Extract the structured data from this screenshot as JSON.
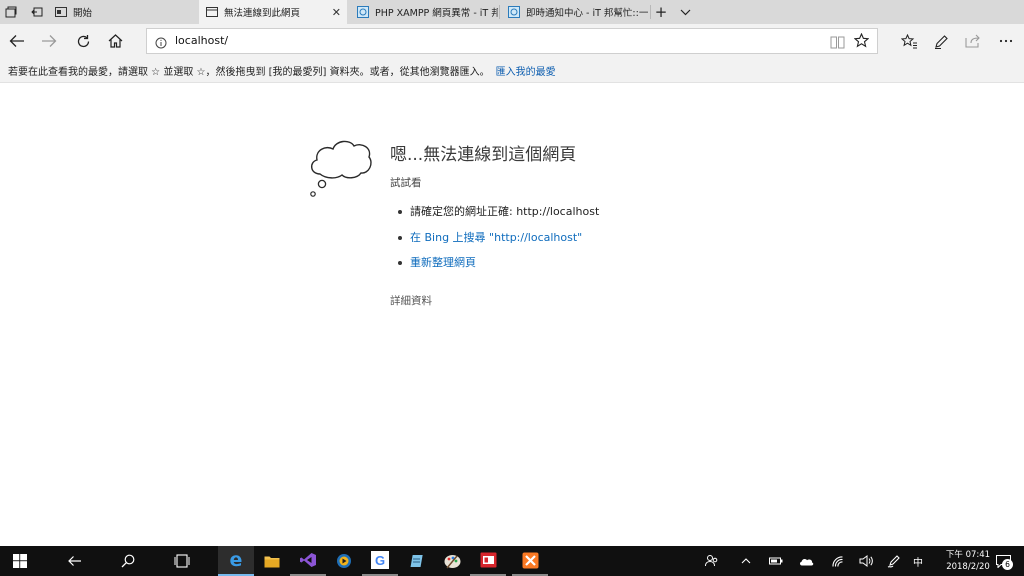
{
  "tabs": [
    {
      "title": "開始",
      "active": false
    },
    {
      "title": "無法連線到此網頁",
      "active": true
    },
    {
      "title": "PHP XAMPP 網頁異常 - iT 邦",
      "active": false
    },
    {
      "title": "即時通知中心 - iT 邦幫忙::一",
      "active": false
    }
  ],
  "tab_close_glyph": "✕",
  "new_tab_glyph": "+",
  "tab_list_glyph": "⌄",
  "address": {
    "url": "localhost/"
  },
  "favorites_bar": {
    "hint": "若要在此查看我的最愛，請選取 ☆ 並選取 ☆，然後拖曳到 [我的最愛列] 資料夾。或者，從其他瀏覽器匯入。",
    "import_link": "匯入我的最愛"
  },
  "error_page": {
    "title": "嗯...無法連線到這個網頁",
    "subtitle": "試試看",
    "suggestions": [
      "請確定您的網址正確: http://localhost",
      "在 Bing 上搜尋 \"http://localhost\"",
      "重新整理網頁"
    ],
    "details": "詳細資料"
  },
  "taskbar": {
    "ime": "中",
    "clock_time": "下午 07:41",
    "clock_date": "2018/2/20",
    "notification_count": "6"
  },
  "colors": {
    "accent_blue": "#0f6cbd",
    "taskbar_bg": "#101010",
    "tab_strip_bg": "#d9d9d9",
    "active_tab_bg": "#f2f2f2"
  }
}
